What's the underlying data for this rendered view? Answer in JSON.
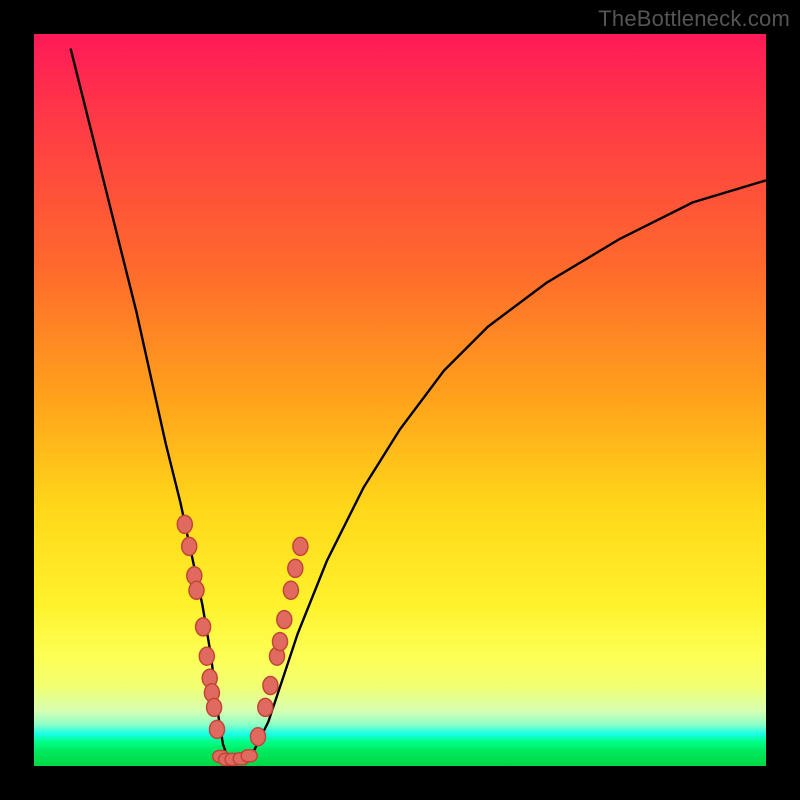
{
  "watermark": "TheBottleneck.com",
  "colors": {
    "frame": "#000000",
    "curve": "#000000",
    "marker_fill": "#e06a5f",
    "marker_stroke": "#c24638",
    "gradient_stops": [
      "#ff1958",
      "#ff6a2c",
      "#ffd81a",
      "#fdff55",
      "#19ffe6",
      "#00d943"
    ]
  },
  "chart_data": {
    "type": "line",
    "title": "",
    "xlabel": "",
    "ylabel": "",
    "xlim": [
      0,
      100
    ],
    "ylim": [
      0,
      100
    ],
    "curve": {
      "x": [
        5,
        8,
        11,
        14,
        16,
        18,
        20,
        21.5,
        23,
        24.2,
        25,
        25.8,
        26.5,
        28,
        30,
        32,
        34,
        36,
        40,
        45,
        50,
        56,
        62,
        70,
        80,
        90,
        100
      ],
      "y": [
        98,
        86,
        74,
        62,
        53,
        44,
        36,
        29,
        22,
        15,
        8,
        3,
        1,
        1,
        2,
        6,
        12,
        18,
        28,
        38,
        46,
        54,
        60,
        66,
        72,
        77,
        80
      ]
    },
    "series": [
      {
        "name": "markers-left-branch",
        "x": [
          20.6,
          21.2,
          21.9,
          22.2,
          23.1,
          23.6,
          24.0,
          24.3,
          24.6,
          25.0
        ],
        "y": [
          33,
          30,
          26,
          24,
          19,
          15,
          12,
          10,
          8,
          5
        ]
      },
      {
        "name": "markers-bottom-flat",
        "x": [
          25.5,
          26.3,
          27.2,
          28.3,
          29.4
        ],
        "y": [
          1.3,
          0.9,
          0.9,
          1.0,
          1.4
        ]
      },
      {
        "name": "markers-right-branch",
        "x": [
          30.6,
          31.6,
          32.3,
          33.2,
          33.6,
          34.2,
          35.1,
          35.7,
          36.4
        ],
        "y": [
          4,
          8,
          11,
          15,
          17,
          20,
          24,
          27,
          30
        ]
      }
    ]
  }
}
